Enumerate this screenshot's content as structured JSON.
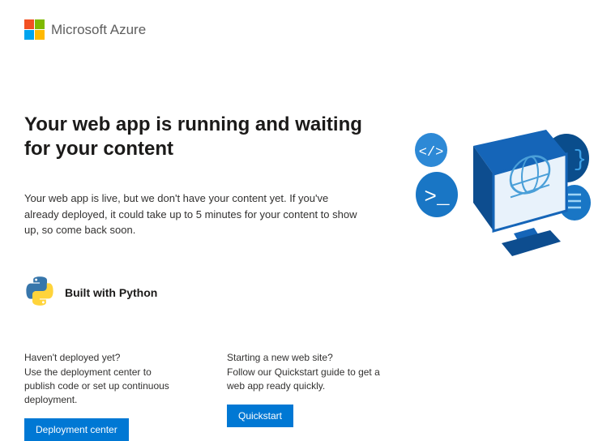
{
  "header": {
    "brand": "Microsoft Azure"
  },
  "main": {
    "title": "Your web app is running and waiting for your content",
    "description": "Your web app is live, but we don't have your content yet. If you've already deployed, it could take up to 5 minutes for your content to show up, so come back soon.",
    "built_with_label": "Built with Python"
  },
  "columns": [
    {
      "heading": "Haven't deployed yet?",
      "text": "Use the deployment center to publish code or set up continuous deployment.",
      "button_label": "Deployment center"
    },
    {
      "heading": "Starting a new web site?",
      "text": "Follow our Quickstart guide to get a web app ready quickly.",
      "button_label": "Quickstart"
    }
  ],
  "colors": {
    "primary": "#0078d4"
  }
}
